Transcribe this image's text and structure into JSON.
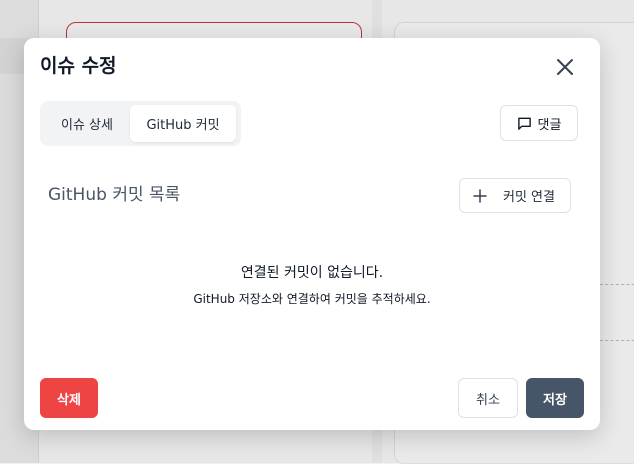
{
  "modal": {
    "title": "이슈 수정",
    "tabs": [
      {
        "label": "이슈 상세",
        "active": false
      },
      {
        "label": "GitHub 커밋",
        "active": true
      }
    ],
    "comment_button": {
      "label": "댓글",
      "icon": "message-square-icon"
    },
    "section": {
      "title": "GitHub 커밋 목록",
      "link_button": {
        "label": "커밋 연결",
        "icon": "plus-icon"
      }
    },
    "empty_state": {
      "title": "연결된 커밋이 없습니다.",
      "subtitle": "GitHub 저장소와 연결하여 커밋을 추적하세요."
    },
    "footer": {
      "delete_label": "삭제",
      "cancel_label": "취소",
      "save_label": "저장"
    }
  },
  "colors": {
    "danger": "#ef4444",
    "primary": "#475569",
    "section_title": "#4b5567"
  }
}
